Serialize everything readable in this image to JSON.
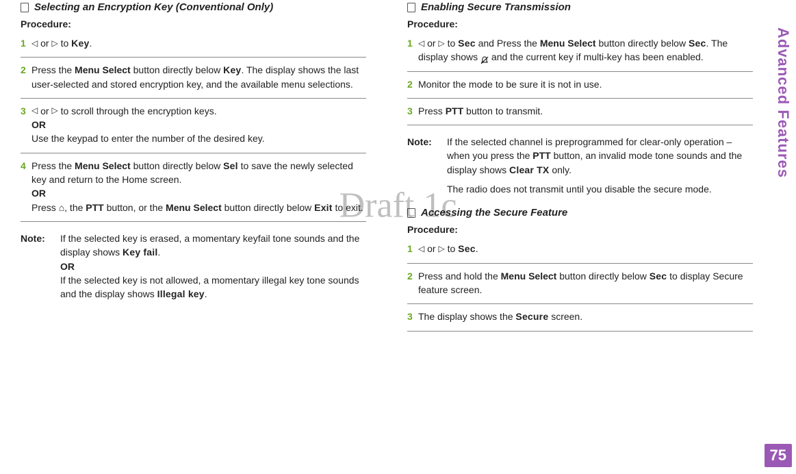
{
  "watermark": "Draft 1c",
  "side_tab": "Advanced Features",
  "page_number": "75",
  "left": {
    "title": "Selecting an Encryption Key (Conventional Only)",
    "procedure_label": "Procedure:",
    "steps": {
      "s1": {
        "num": "1",
        "t1": " or ",
        "t2": " to ",
        "key": "Key",
        "t3": "."
      },
      "s2": {
        "num": "2",
        "t1": "Press the ",
        "ui1": "Menu Select",
        "t2": " button directly below ",
        "key": "Key",
        "t3": ". The display shows the last user-selected and stored encryption key, and the available menu selections."
      },
      "s3": {
        "num": "3",
        "line1a": " or ",
        "line1b": " to scroll through the encryption keys.",
        "or": "OR",
        "line2": "Use the keypad to enter the number of the desired key."
      },
      "s4": {
        "num": "4",
        "t1": "Press the ",
        "ui1": "Menu Select",
        "t2": " button directly below ",
        "sel": "Sel",
        "t3": " to save the newly selected key and return to the Home screen.",
        "or": "OR",
        "t4": "Press ",
        "t5": ", the ",
        "ptt": "PTT",
        "t6": " button, or the ",
        "ui2": "Menu Select",
        "t7": " button directly below ",
        "exit": "Exit",
        "t8": " to exit."
      }
    },
    "note": {
      "label": "Note:",
      "t1": "If the selected key is erased, a momentary keyfail tone sounds and the display shows ",
      "keyfail": "Key fail",
      "t1b": ".",
      "or": "OR",
      "t2": "If the selected key is not allowed, a momentary illegal key tone sounds and the display shows ",
      "illegal": "Illegal key",
      "t2b": "."
    }
  },
  "right": {
    "sec1": {
      "title": "Enabling Secure Transmission",
      "procedure_label": "Procedure:",
      "s1": {
        "num": "1",
        "a": " or ",
        "b": " to ",
        "sec": "Sec",
        "c": " and Press the ",
        "ui": "Menu Select",
        "d": " button directly below ",
        "sec2": "Sec",
        "e": ". The display shows ",
        "f": " and the current key if multi-key has been enabled."
      },
      "s2": {
        "num": "2",
        "text": "Monitor the mode to be sure it is not in use."
      },
      "s3": {
        "num": "3",
        "a": "Press ",
        "ptt": "PTT",
        "b": " button to transmit."
      },
      "note": {
        "label": "Note:",
        "t1": "If the selected channel is preprogrammed for clear-only operation – when you press the ",
        "ptt": "PTT",
        "t2": " button, an invalid mode tone sounds and the display shows ",
        "clear": "Clear TX",
        "t3": " only.",
        "t4": "The radio does not transmit until you disable the secure mode."
      }
    },
    "sec2": {
      "title": "Accessing the Secure Feature",
      "procedure_label": "Procedure:",
      "s1": {
        "num": "1",
        "a": " or ",
        "b": " to ",
        "sec": "Sec",
        "c": "."
      },
      "s2": {
        "num": "2",
        "a": "Press and hold the ",
        "ui": "Menu Select",
        "b": " button directly below ",
        "sec": "Sec",
        "c": " to display Secure feature screen."
      },
      "s3": {
        "num": "3",
        "a": "The display shows the ",
        "secure": "Secure",
        "b": " screen."
      }
    }
  }
}
